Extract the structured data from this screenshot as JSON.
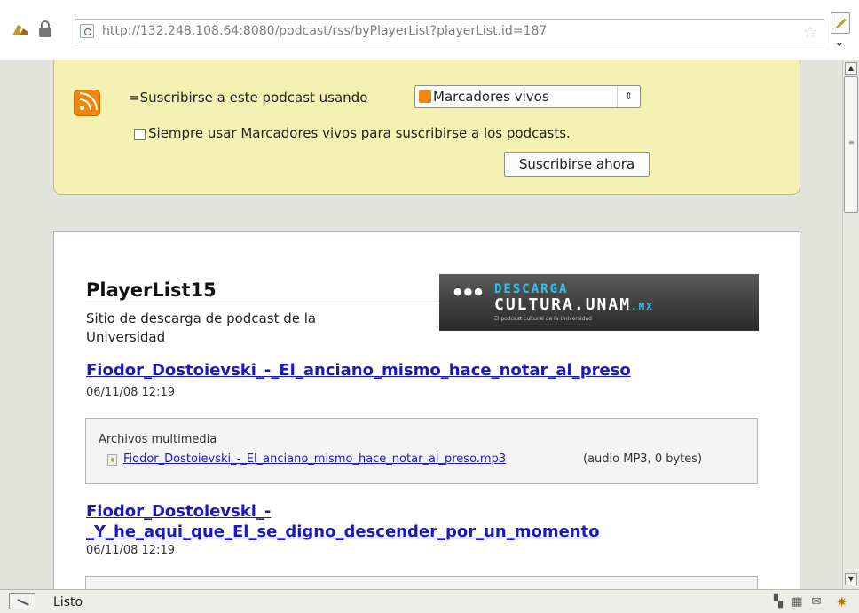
{
  "browser": {
    "url": "http://132.248.108.64:8080/podcast/rss/byPlayerList?playerList.id=187",
    "status": "Listo",
    "status_icons": "▚ ▦ ✉",
    "status_bug": "✷",
    "star": "☆",
    "dropdown": "⌄"
  },
  "subscribe": {
    "label": "=Suscribirse a este podcast usando",
    "selected_option": "Marcadores vivos",
    "select_arrow": "⇕",
    "always_use_label": "Siempre usar Marcadores vivos para suscribirse a los podcasts.",
    "always_use_checked": false,
    "button_label": "Suscribirse ahora",
    "accent_color": "#f1860a"
  },
  "feed": {
    "title": "PlayerList15",
    "description": "Sitio de descarga de podcast de la Universidad",
    "logo": {
      "dots": "●●●",
      "line1": "DESCARGA",
      "line2": "CULTURA.UNAM",
      "line2_suffix": ".MX",
      "tagline": "El podcast cultural de la Universidad"
    },
    "entries": [
      {
        "title": "Fiodor_Dostoievski_-_El_anciano_mismo_hace_notar_al_preso",
        "date": "06/11/08 12:19",
        "media_header": "Archivos multimedia",
        "file_name": "Fiodor_Dostoievski_-_El_anciano_mismo_hace_notar_al_preso.mp3",
        "file_meta": "(audio MP3, 0 bytes)"
      },
      {
        "title_line1": "Fiodor_Dostoievski_-",
        "title_line2": "_Y_he_aqui_que_El_se_digno_descender_por_un_momento",
        "date": "06/11/08 12:19"
      }
    ]
  },
  "scrollbar": {
    "up": "▲",
    "down": "▼",
    "grip": "≡"
  }
}
